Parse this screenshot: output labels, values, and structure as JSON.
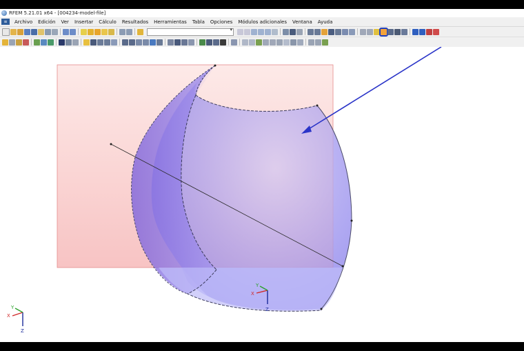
{
  "window": {
    "title": "RFEM 5.21.01 x64 - [004234-model-file]"
  },
  "menu": {
    "items": [
      "Archivo",
      "Edición",
      "Ver",
      "Insertar",
      "Cálculo",
      "Resultados",
      "Herramientas",
      "Tabla",
      "Opciones",
      "Módulos adicionales",
      "Ventana",
      "Ayuda"
    ]
  },
  "toolbar": {
    "load_case_value": "",
    "highlighted_tool": "x-mark-icon"
  },
  "axes": {
    "x": "X",
    "y": "Y",
    "z": "Z"
  },
  "colors": {
    "accent_highlight": "#1f3fbf",
    "shell_fill": "#9a8ef0",
    "plane_fill": "#f7c4c4",
    "arrow": "#2a34c8"
  }
}
